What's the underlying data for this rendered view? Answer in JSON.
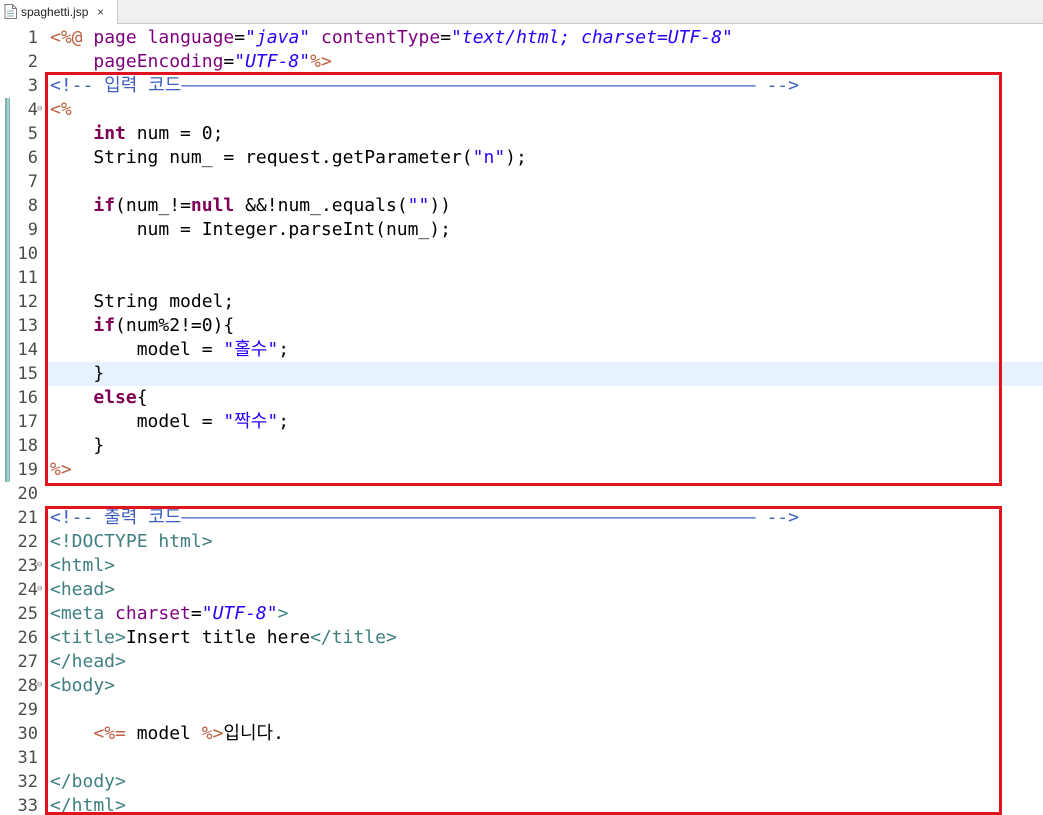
{
  "tab": {
    "filename": "spaghetti.jsp",
    "close_glyph": "×"
  },
  "line_numbers": [
    "1",
    "2",
    "3",
    "4",
    "5",
    "6",
    "7",
    "8",
    "9",
    "10",
    "11",
    "12",
    "13",
    "14",
    "15",
    "16",
    "17",
    "18",
    "19",
    "20",
    "21",
    "22",
    "23",
    "24",
    "25",
    "26",
    "27",
    "28",
    "29",
    "30",
    "31",
    "32",
    "33"
  ],
  "code": {
    "l1": {
      "open": "<%@",
      "sp0": " ",
      "page": "page",
      "sp1": " ",
      "lang_attr": "language",
      "eq1": "=",
      "lang_val": "\"java\"",
      "sp2": " ",
      "ct_attr": "contentType",
      "eq2": "=",
      "ct_val": "\"text/html; charset=UTF-8\""
    },
    "l2": {
      "indent": "    ",
      "pe_attr": "pageEncoding",
      "eq": "=",
      "pe_val": "\"UTF-8\"",
      "close": "%>"
    },
    "l3": {
      "comment": "<!-- 입력 코드————————————————————————————————————————————————————— -->"
    },
    "l4": {
      "open": "<%"
    },
    "l5": {
      "indent": "    ",
      "kw": "int",
      "rest": " num = 0;"
    },
    "l6": {
      "text": "    String num_ = request.getParameter(",
      "str": "\"n\"",
      "end": ");"
    },
    "l8": {
      "indent": "    ",
      "kw_if": "if",
      "mid": "(num_!=",
      "kw_null": "null",
      "mid2": " &&!num_.equals(",
      "str": "\"\"",
      "end": "))"
    },
    "l9": {
      "text": "        num = Integer.parseInt(num_);"
    },
    "l12": {
      "text": "    String model;"
    },
    "l13": {
      "indent": "    ",
      "kw": "if",
      "rest": "(num%2!=0){"
    },
    "l14": {
      "text": "        model = ",
      "str": "\"홀수\"",
      "end": ";"
    },
    "l15": {
      "text": "    }"
    },
    "l16": {
      "indent": "    ",
      "kw": "else",
      "rest": "{"
    },
    "l17": {
      "text": "        model = ",
      "str": "\"짝수\"",
      "end": ";"
    },
    "l18": {
      "text": "    }"
    },
    "l19": {
      "close": "%>"
    },
    "l21": {
      "comment": "<!-- 출력 코드————————————————————————————————————————————————————— -->"
    },
    "l22": {
      "doctype": "<!DOCTYPE",
      "rest": " html>"
    },
    "l23": {
      "tag": "<html>"
    },
    "l24": {
      "tag": "<head>"
    },
    "l25": {
      "open": "<meta",
      "sp": " ",
      "attr": "charset",
      "eq": "=",
      "val": "\"UTF-8\"",
      "close": ">"
    },
    "l26": {
      "open": "<title>",
      "text": "Insert title here",
      "close": "</title>"
    },
    "l27": {
      "tag": "</head>"
    },
    "l28": {
      "tag": "<body>"
    },
    "l30": {
      "indent": "    ",
      "open": "<%=",
      "expr": " model ",
      "close": "%>",
      "text": "입니다."
    },
    "l32": {
      "tag": "</body>"
    },
    "l33": {
      "tag": "</html>"
    }
  },
  "colors": {
    "highlight_border": "#e0141e",
    "keyword": "#7f0055",
    "jsp_delimiter": "#bf5f3f",
    "string": "#2a00ff",
    "html_tag": "#3f7f7f",
    "comment": "#3f5fbf",
    "current_line": "#e8f2fe"
  }
}
